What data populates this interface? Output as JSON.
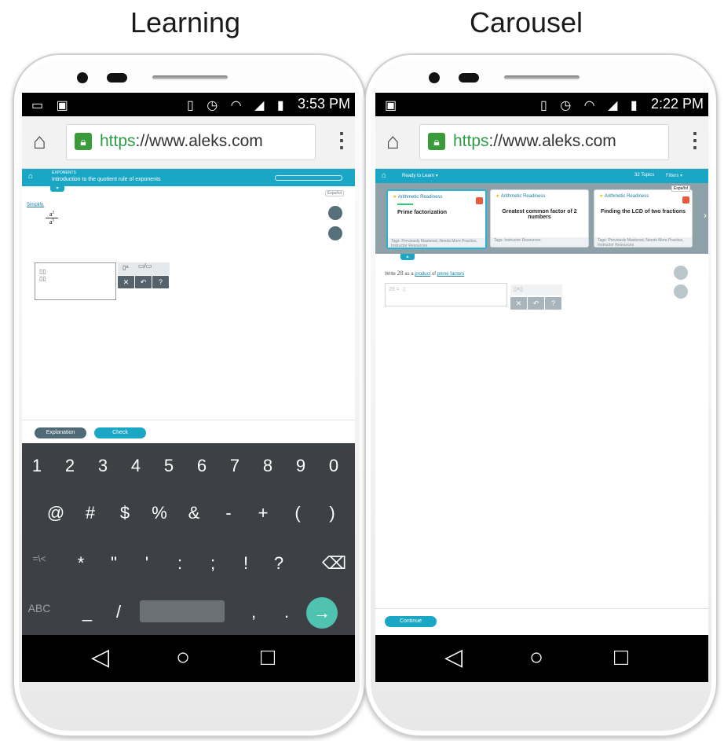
{
  "titles": {
    "left": "Learning",
    "right": "Carousel"
  },
  "left": {
    "status_time": "3:53 PM",
    "url_scheme": "https",
    "url_rest": "://www.aleks.com",
    "topic_section": "EXPONENTS",
    "topic_title": "Introduction to the quotient rule of exponents",
    "espanol": "Español",
    "prompt": "Simplify.",
    "explanation_label": "Explanation",
    "check_label": "Check",
    "kb_row1": [
      "1",
      "2",
      "3",
      "4",
      "5",
      "6",
      "7",
      "8",
      "9",
      "0"
    ],
    "kb_row2": [
      "@",
      "#",
      "$",
      "%",
      "&",
      "-",
      "+",
      "(",
      ")"
    ],
    "kb_row3": [
      "=\\<",
      "*",
      "\"",
      "'",
      ":",
      ";",
      "!",
      "?"
    ],
    "kb_row4": [
      "ABC",
      "_",
      "/",
      ",",
      "."
    ]
  },
  "right": {
    "status_time": "2:22 PM",
    "url_scheme": "https",
    "url_rest": "://www.aleks.com",
    "ready_label": "Ready to Learn ▾",
    "topics_count": "32 Topics",
    "filters_label": "Filters ▾",
    "espanol": "Español",
    "cards": [
      {
        "category": "Arithmetic Readiness",
        "title": "Prime factorization",
        "tags": "Tags: Previously Mastered, Needs More Practice, Instructor Resources"
      },
      {
        "category": "Arithmetic Readiness",
        "title": "Greatest common factor of 2 numbers",
        "tags": "Tags: Instructor Resources"
      },
      {
        "category": "Arithmetic Readiness",
        "title": "Finding the LCD of two fractions",
        "tags": "Tags: Previously Mastered, Needs More Practice, Instructor Resources"
      }
    ],
    "question_prefix": "Write",
    "question_number": "28",
    "question_mid": "as a",
    "question_link1": "product",
    "question_of": "of",
    "question_link2": "prime factors",
    "answer_prefix": "28 =",
    "continue_label": "Continue"
  },
  "colors": {
    "teal": "#1aa7c5",
    "kb": "#3d4145",
    "green_lock": "#3a9b3a",
    "nav": "#000000"
  },
  "icons": [
    "home-icon",
    "lock-icon",
    "overflow-menu-icon",
    "back-icon",
    "home-circle-icon",
    "recents-icon",
    "wifi-icon",
    "alarm-icon",
    "signal-icon",
    "battery-icon",
    "backspace-icon",
    "enter-arrow-icon"
  ]
}
